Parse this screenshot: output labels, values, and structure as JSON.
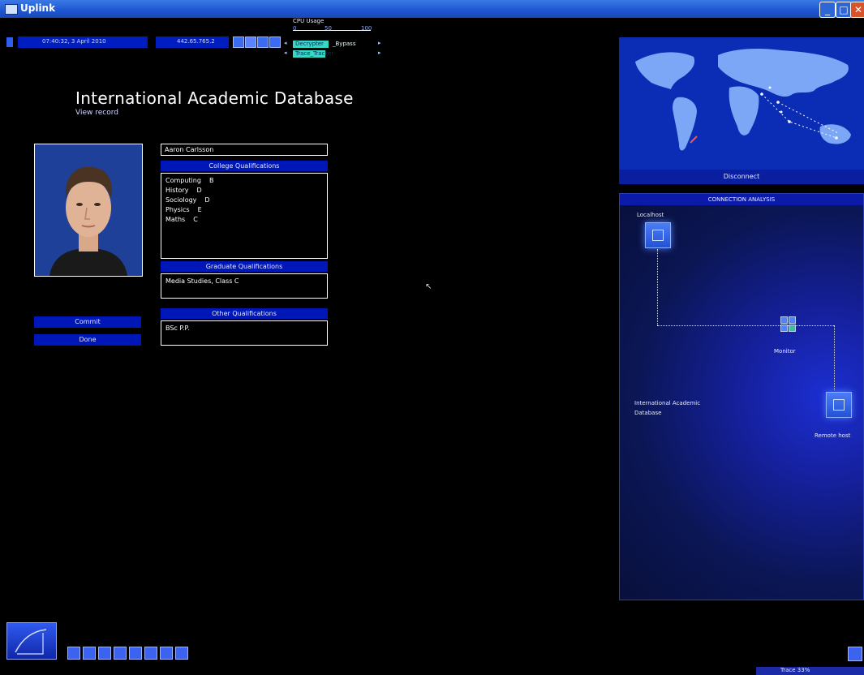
{
  "window": {
    "title": "Uplink"
  },
  "topbar": {
    "datetime": "07:40:32, 3 April 2010",
    "ip": "442.65.765.2",
    "cpu_label": "CPU Usage",
    "cpu_ticks": [
      "0",
      "50",
      "100"
    ],
    "tasks": [
      {
        "label": "Decrypter",
        "suffix": "_Bypass",
        "fill_fraction": 0.55
      },
      {
        "label": "Trace_Tracker",
        "suffix": "",
        "fill_fraction": 0.45
      }
    ]
  },
  "page": {
    "heading": "International Academic Database",
    "subheading": "View record"
  },
  "record": {
    "name": "Aaron Carlsson",
    "college_header": "College Qualifications",
    "college": [
      {
        "subject": "Computing",
        "grade": "B"
      },
      {
        "subject": "History",
        "grade": "D"
      },
      {
        "subject": "Sociology",
        "grade": "D"
      },
      {
        "subject": "Physics",
        "grade": "E"
      },
      {
        "subject": "Maths",
        "grade": "C"
      }
    ],
    "graduate_header": "Graduate Qualifications",
    "graduate": "Media Studies, Class C",
    "other_header": "Other Qualifications",
    "other": "BSc P.P."
  },
  "buttons": {
    "commit": "Commit",
    "done": "Done"
  },
  "map": {
    "footer": "Disconnect"
  },
  "connection": {
    "title": "CONNECTION ANALYSIS",
    "localhost": "Localhost",
    "monitor": "Monitor",
    "target": "International Academic Database",
    "remote": "Remote host"
  },
  "tray": {
    "label": "Trace 33%"
  },
  "colors": {
    "accent": "#0017b8",
    "panel": "#15209c",
    "cpu_bar": "#39d6c4"
  }
}
